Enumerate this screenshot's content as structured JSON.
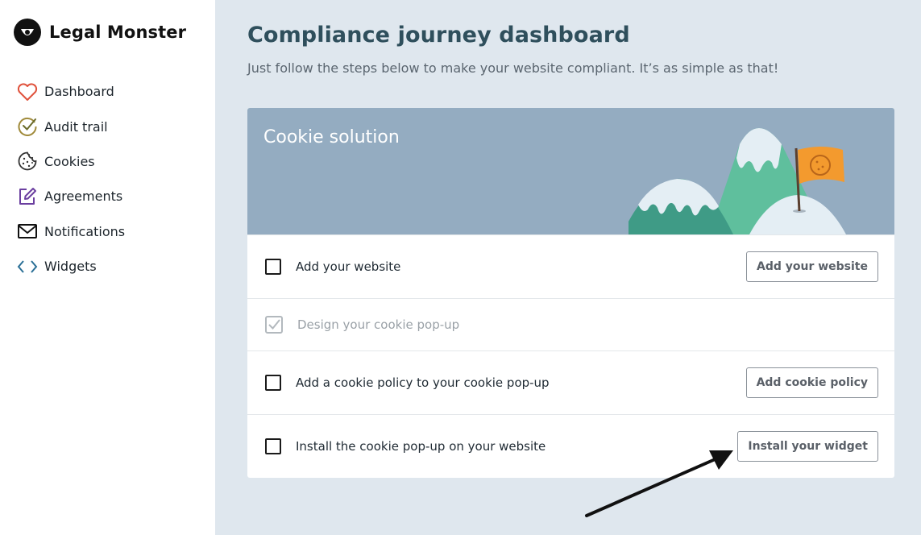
{
  "brand": {
    "name": "Legal Monster",
    "logo_icon": "monster-logo-icon"
  },
  "sidebar": {
    "items": [
      {
        "label": "Dashboard",
        "icon": "heart-icon",
        "color": "#e0533d"
      },
      {
        "label": "Audit trail",
        "icon": "check-circle-icon",
        "color": "#a08a3a"
      },
      {
        "label": "Cookies",
        "icon": "cookie-icon",
        "color": "#333333"
      },
      {
        "label": "Agreements",
        "icon": "edit-icon",
        "color": "#6b3fa0"
      },
      {
        "label": "Notifications",
        "icon": "envelope-icon",
        "color": "#111111"
      },
      {
        "label": "Widgets",
        "icon": "code-icon",
        "color": "#2a6f96"
      }
    ]
  },
  "main": {
    "title": "Compliance journey dashboard",
    "subtitle": "Just follow the steps below to make your website compliant. It’s as simple as that!"
  },
  "card": {
    "title": "Cookie solution",
    "header_color": "#94acc1",
    "illustration": "mountains-flag-illustration",
    "steps": [
      {
        "label": "Add your website",
        "done": false,
        "button": "Add your website"
      },
      {
        "label": "Design your cookie pop-up",
        "done": true,
        "button": ""
      },
      {
        "label": "Add a cookie policy to your cookie pop-up",
        "done": false,
        "button": "Add cookie policy"
      },
      {
        "label": "Install the cookie pop-up on your website",
        "done": false,
        "button": "Install your widget"
      }
    ]
  },
  "annotation": {
    "icon": "arrow-annotation-icon"
  }
}
